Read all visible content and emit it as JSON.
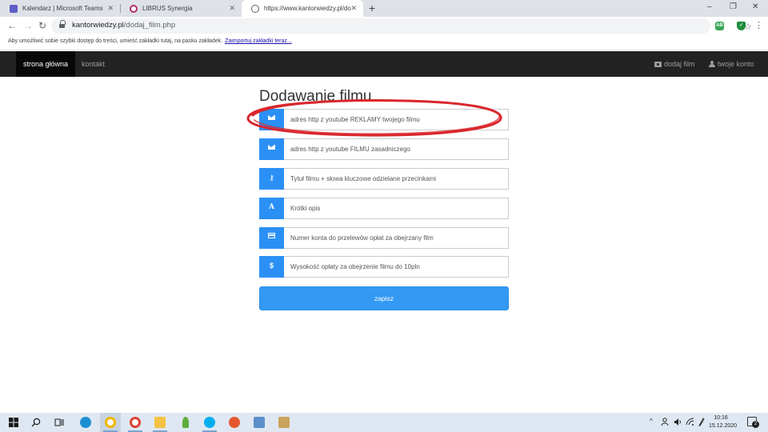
{
  "browser": {
    "tabs": [
      {
        "title": "Kalendarz | Microsoft Teams",
        "icon": "teams-icon",
        "color": "#5b5fc7"
      },
      {
        "title": "LIBRUS Synergia",
        "icon": "librus-icon",
        "color": "#b0306a"
      },
      {
        "title": "https://www.kantorwiedzy.pl/do",
        "icon": "globe-icon",
        "color": "#5f6368"
      }
    ],
    "new_tab_glyph": "+",
    "window_controls": {
      "minimize": "–",
      "maximize": "❐",
      "close": "✕"
    },
    "nav": {
      "back": "←",
      "forward": "→",
      "reload": "↻"
    },
    "url_host": "kantorwiedzy.pl",
    "url_path": "/dodaj_film.php",
    "star_glyph": "☆",
    "menu_glyph": "⋮",
    "extensions": [
      {
        "label": "AB",
        "icon": "adblock-icon",
        "color": "#3aa757"
      },
      {
        "label": "✓",
        "icon": "shield-check-icon",
        "color": "#1e8e3e"
      }
    ]
  },
  "bookmarks_bar": {
    "hint": "Aby umożliwić sobie szybki dostęp do treści, umieść zakładki tutaj, na pasku zakładek.",
    "import_link": "Zaimportuj zakładki teraz..."
  },
  "site_nav": {
    "home": "strona główna",
    "contact": "kontakt",
    "add_film": "dodaj film",
    "account": "twoje konto"
  },
  "form": {
    "title": "Dodawanie filmu",
    "fields": [
      {
        "name": "ad-url-input",
        "icon": "envelope-icon",
        "placeholder": "adres http z youtube REKLAMY twojego filmu"
      },
      {
        "name": "film-url-input",
        "icon": "envelope-icon",
        "placeholder": "adres http z youtube  FILMU zasadniczego"
      },
      {
        "name": "title-keywords-input",
        "icon": "key-icon",
        "glyph": "⚷",
        "placeholder": "Tytuł filmu + słowa kluczowe odzielane przecinkami"
      },
      {
        "name": "short-description-input",
        "icon": "font-icon",
        "glyph": "A",
        "placeholder": "Krótki opis"
      },
      {
        "name": "account-number-input",
        "icon": "credit-card-icon",
        "placeholder": "Numer konta do przelewów opłat za obejrzany film"
      },
      {
        "name": "fee-input",
        "icon": "dollar-icon",
        "glyph": "$",
        "placeholder": "Wysokość opłaty za obejrzenie filmu do 10pln"
      }
    ],
    "submit": "zapisz"
  },
  "annotation": {
    "color": "#d9262c"
  },
  "taskbar": {
    "apps": [
      {
        "icon": "windows-start-icon",
        "color": "#1a1a1a"
      },
      {
        "icon": "search-icon",
        "color": "#1a1a1a"
      },
      {
        "icon": "task-view-icon",
        "color": "#1a1a1a"
      },
      {
        "icon": "edge-icon",
        "color": "#1b8fd4"
      },
      {
        "icon": "chrome-canary-icon",
        "color": "#f2b600"
      },
      {
        "icon": "chrome-icon",
        "color": "#db4437"
      },
      {
        "icon": "file-explorer-icon",
        "color": "#f3c244"
      },
      {
        "icon": "plant-app-icon",
        "color": "#5fae3a"
      },
      {
        "icon": "skype-icon",
        "color": "#00aff0"
      },
      {
        "icon": "record-app-icon",
        "color": "#e4572e"
      },
      {
        "icon": "disk-app-icon",
        "color": "#5b8fc9"
      },
      {
        "icon": "paint-app-icon",
        "color": "#caa45d"
      }
    ],
    "tray": {
      "chevron": "^",
      "time": "10:16",
      "date": "15.12.2020",
      "notifications": "2"
    }
  }
}
